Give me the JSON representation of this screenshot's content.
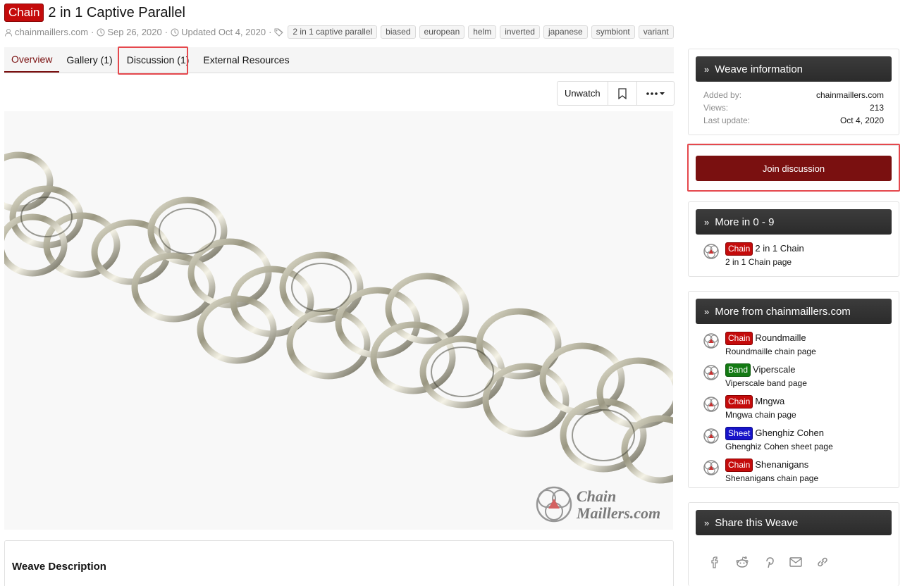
{
  "header": {
    "type_label": "Chain",
    "title": "2 in 1 Captive Parallel",
    "author": "chainmaillers.com",
    "date": "Sep 26, 2020",
    "updated": "Updated Oct 4, 2020",
    "tags": [
      "2 in 1 captive parallel",
      "biased",
      "european",
      "helm",
      "inverted",
      "japanese",
      "symbiont",
      "variant"
    ]
  },
  "tabs": [
    {
      "label": "Overview"
    },
    {
      "label": "Gallery (1)"
    },
    {
      "label": "Discussion (1)"
    },
    {
      "label": "External Resources"
    }
  ],
  "actions": {
    "unwatch": "Unwatch"
  },
  "image": {
    "watermark_line1": "Chain",
    "watermark_line2": "Maillers.com"
  },
  "description": {
    "title": "Weave Description"
  },
  "weave_info": {
    "title": "Weave information",
    "rows": [
      {
        "k": "Added by:",
        "v": "chainmaillers.com"
      },
      {
        "k": "Views:",
        "v": "213"
      },
      {
        "k": "Last update:",
        "v": "Oct 4, 2020"
      }
    ]
  },
  "join": {
    "label": "Join discussion"
  },
  "more_in": {
    "title": "More in 0 - 9",
    "items": [
      {
        "label": "Chain",
        "name": "2 in 1 Chain",
        "sub": "2 in 1 Chain page"
      }
    ]
  },
  "more_from": {
    "title": "More from chainmaillers.com",
    "items": [
      {
        "label": "Chain",
        "name": "Roundmaille",
        "sub": "Roundmaille chain page"
      },
      {
        "label": "Band",
        "name": "Viperscale",
        "sub": "Viperscale band page"
      },
      {
        "label": "Chain",
        "name": "Mngwa",
        "sub": "Mngwa chain page"
      },
      {
        "label": "Sheet",
        "name": "Ghenghiz Cohen",
        "sub": "Ghenghiz Cohen sheet page"
      },
      {
        "label": "Chain",
        "name": "Shenanigans",
        "sub": "Shenanigans chain page"
      }
    ]
  },
  "share": {
    "title": "Share this Weave"
  },
  "colors": {
    "accent": "#7a1010",
    "chain_label": "#c40b0b",
    "band_label": "#137a13",
    "sheet_label": "#1713c9",
    "highlight": "#e5484d"
  }
}
